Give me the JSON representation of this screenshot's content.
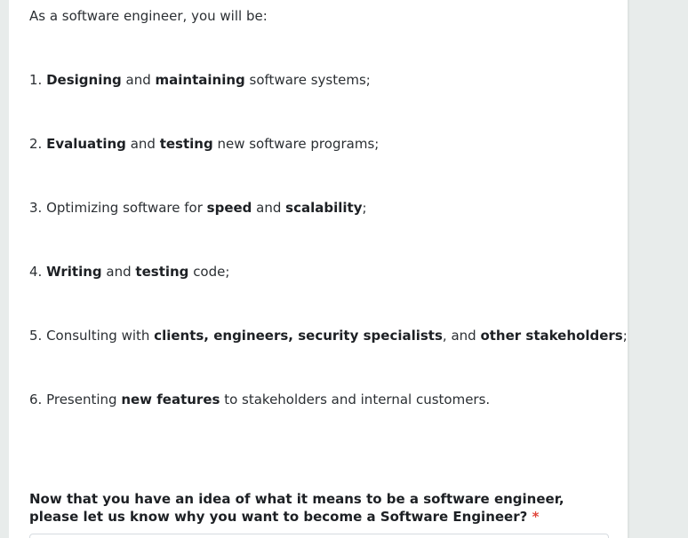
{
  "intro": "As a software engineer, you will be:",
  "items": [
    {
      "n": "1. ",
      "b1": "Designing",
      "t1": " and ",
      "b2": "maintaining",
      "t2": " software systems;"
    },
    {
      "n": "2. ",
      "b1": "Evaluating",
      "t1": " and ",
      "b2": "testing",
      "t2": " new software programs;"
    },
    {
      "n": "3. Optimizing software for ",
      "b1": "speed",
      "t1": " and ",
      "b2": "scalability",
      "t2": ";"
    },
    {
      "n": "4. ",
      "b1": "Writing",
      "t1": " and ",
      "b2": "testing",
      "t2": " code;"
    },
    {
      "n": "5. Consulting with ",
      "b1": "clients, engineers, security specialists",
      "t1": ", and ",
      "b2": "other stakeholders",
      "t2": ";"
    },
    {
      "n": "6. Presenting ",
      "b1": "new features",
      "t1": " to stakeholders and internal customers.",
      "b2": "",
      "t2": ""
    }
  ],
  "question": {
    "label": "Now that you have an idea of what it means to be a software engineer, please let us know why you want to become a Software Engineer?",
    "required_mark": "*",
    "answer_value": ""
  },
  "colors": {
    "page_bg": "#e8eceb",
    "card_bg": "#ffffff",
    "text": "#2b2f33",
    "required": "#e0453a"
  }
}
